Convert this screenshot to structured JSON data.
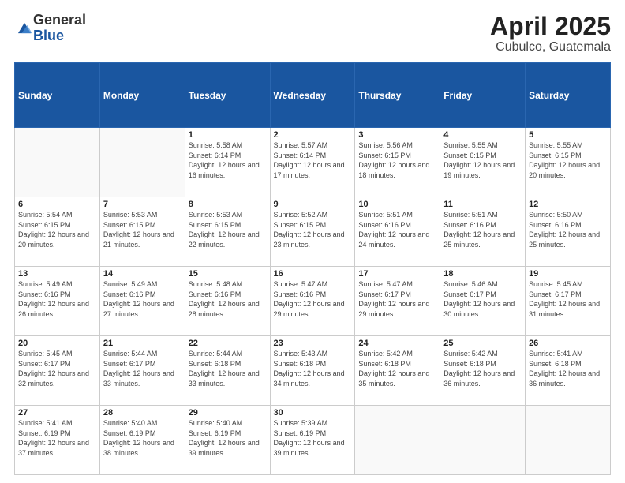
{
  "logo": {
    "general": "General",
    "blue": "Blue"
  },
  "title": "April 2025",
  "subtitle": "Cubulco, Guatemala",
  "days_of_week": [
    "Sunday",
    "Monday",
    "Tuesday",
    "Wednesday",
    "Thursday",
    "Friday",
    "Saturday"
  ],
  "weeks": [
    [
      {
        "day": "",
        "info": ""
      },
      {
        "day": "",
        "info": ""
      },
      {
        "day": "1",
        "info": "Sunrise: 5:58 AM\nSunset: 6:14 PM\nDaylight: 12 hours and 16 minutes."
      },
      {
        "day": "2",
        "info": "Sunrise: 5:57 AM\nSunset: 6:14 PM\nDaylight: 12 hours and 17 minutes."
      },
      {
        "day": "3",
        "info": "Sunrise: 5:56 AM\nSunset: 6:15 PM\nDaylight: 12 hours and 18 minutes."
      },
      {
        "day": "4",
        "info": "Sunrise: 5:55 AM\nSunset: 6:15 PM\nDaylight: 12 hours and 19 minutes."
      },
      {
        "day": "5",
        "info": "Sunrise: 5:55 AM\nSunset: 6:15 PM\nDaylight: 12 hours and 20 minutes."
      }
    ],
    [
      {
        "day": "6",
        "info": "Sunrise: 5:54 AM\nSunset: 6:15 PM\nDaylight: 12 hours and 20 minutes."
      },
      {
        "day": "7",
        "info": "Sunrise: 5:53 AM\nSunset: 6:15 PM\nDaylight: 12 hours and 21 minutes."
      },
      {
        "day": "8",
        "info": "Sunrise: 5:53 AM\nSunset: 6:15 PM\nDaylight: 12 hours and 22 minutes."
      },
      {
        "day": "9",
        "info": "Sunrise: 5:52 AM\nSunset: 6:15 PM\nDaylight: 12 hours and 23 minutes."
      },
      {
        "day": "10",
        "info": "Sunrise: 5:51 AM\nSunset: 6:16 PM\nDaylight: 12 hours and 24 minutes."
      },
      {
        "day": "11",
        "info": "Sunrise: 5:51 AM\nSunset: 6:16 PM\nDaylight: 12 hours and 25 minutes."
      },
      {
        "day": "12",
        "info": "Sunrise: 5:50 AM\nSunset: 6:16 PM\nDaylight: 12 hours and 25 minutes."
      }
    ],
    [
      {
        "day": "13",
        "info": "Sunrise: 5:49 AM\nSunset: 6:16 PM\nDaylight: 12 hours and 26 minutes."
      },
      {
        "day": "14",
        "info": "Sunrise: 5:49 AM\nSunset: 6:16 PM\nDaylight: 12 hours and 27 minutes."
      },
      {
        "day": "15",
        "info": "Sunrise: 5:48 AM\nSunset: 6:16 PM\nDaylight: 12 hours and 28 minutes."
      },
      {
        "day": "16",
        "info": "Sunrise: 5:47 AM\nSunset: 6:16 PM\nDaylight: 12 hours and 29 minutes."
      },
      {
        "day": "17",
        "info": "Sunrise: 5:47 AM\nSunset: 6:17 PM\nDaylight: 12 hours and 29 minutes."
      },
      {
        "day": "18",
        "info": "Sunrise: 5:46 AM\nSunset: 6:17 PM\nDaylight: 12 hours and 30 minutes."
      },
      {
        "day": "19",
        "info": "Sunrise: 5:45 AM\nSunset: 6:17 PM\nDaylight: 12 hours and 31 minutes."
      }
    ],
    [
      {
        "day": "20",
        "info": "Sunrise: 5:45 AM\nSunset: 6:17 PM\nDaylight: 12 hours and 32 minutes."
      },
      {
        "day": "21",
        "info": "Sunrise: 5:44 AM\nSunset: 6:17 PM\nDaylight: 12 hours and 33 minutes."
      },
      {
        "day": "22",
        "info": "Sunrise: 5:44 AM\nSunset: 6:18 PM\nDaylight: 12 hours and 33 minutes."
      },
      {
        "day": "23",
        "info": "Sunrise: 5:43 AM\nSunset: 6:18 PM\nDaylight: 12 hours and 34 minutes."
      },
      {
        "day": "24",
        "info": "Sunrise: 5:42 AM\nSunset: 6:18 PM\nDaylight: 12 hours and 35 minutes."
      },
      {
        "day": "25",
        "info": "Sunrise: 5:42 AM\nSunset: 6:18 PM\nDaylight: 12 hours and 36 minutes."
      },
      {
        "day": "26",
        "info": "Sunrise: 5:41 AM\nSunset: 6:18 PM\nDaylight: 12 hours and 36 minutes."
      }
    ],
    [
      {
        "day": "27",
        "info": "Sunrise: 5:41 AM\nSunset: 6:19 PM\nDaylight: 12 hours and 37 minutes."
      },
      {
        "day": "28",
        "info": "Sunrise: 5:40 AM\nSunset: 6:19 PM\nDaylight: 12 hours and 38 minutes."
      },
      {
        "day": "29",
        "info": "Sunrise: 5:40 AM\nSunset: 6:19 PM\nDaylight: 12 hours and 39 minutes."
      },
      {
        "day": "30",
        "info": "Sunrise: 5:39 AM\nSunset: 6:19 PM\nDaylight: 12 hours and 39 minutes."
      },
      {
        "day": "",
        "info": ""
      },
      {
        "day": "",
        "info": ""
      },
      {
        "day": "",
        "info": ""
      }
    ]
  ]
}
